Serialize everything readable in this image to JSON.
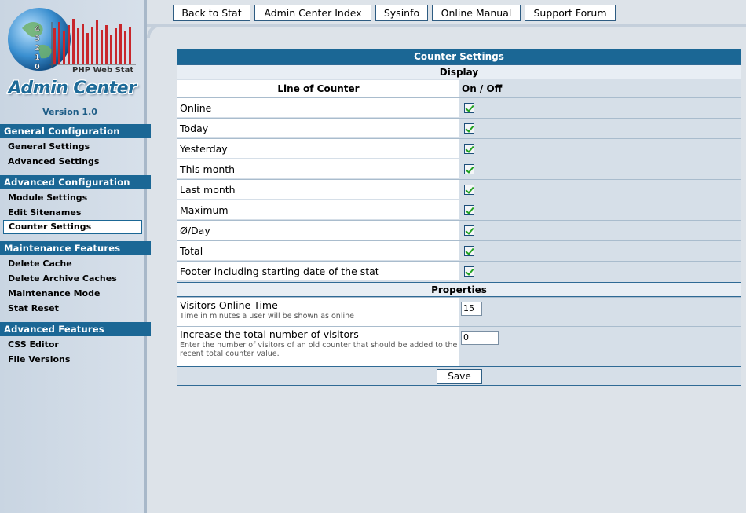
{
  "logo": {
    "brand_text": "PHP Web Stat",
    "title": "Admin Center",
    "version": "Version 1.0"
  },
  "sidebar": {
    "sections": [
      {
        "heading": "General Configuration",
        "items": [
          "General Settings",
          "Advanced Settings"
        ]
      },
      {
        "heading": "Advanced Configuration",
        "items": [
          "Module Settings",
          "Edit Sitenames",
          "Counter Settings"
        ]
      },
      {
        "heading": "Maintenance Features",
        "items": [
          "Delete Cache",
          "Delete Archive Caches",
          "Maintenance Mode",
          "Stat Reset"
        ]
      },
      {
        "heading": "Advanced Features",
        "items": [
          "CSS Editor",
          "File Versions"
        ]
      }
    ],
    "active_item": "Counter Settings"
  },
  "topnav": [
    "Back to Stat",
    "Admin Center Index",
    "Sysinfo",
    "Online Manual",
    "Support Forum"
  ],
  "main": {
    "title": "Counter Settings",
    "display_heading": "Display",
    "col_line": "Line of Counter",
    "col_onoff": "On / Off",
    "rows": [
      {
        "label": "Online",
        "checked": true
      },
      {
        "label": "Today",
        "checked": true
      },
      {
        "label": "Yesterday",
        "checked": true
      },
      {
        "label": "This month",
        "checked": true
      },
      {
        "label": "Last month",
        "checked": true
      },
      {
        "label": "Maximum",
        "checked": true
      },
      {
        "label": "Ø/Day",
        "checked": true
      },
      {
        "label": "Total",
        "checked": true
      },
      {
        "label": "Footer including starting date of the stat",
        "checked": true
      }
    ],
    "properties_heading": "Properties",
    "properties": [
      {
        "title": "Visitors Online Time",
        "desc": "Time in minutes a user will be shown as online",
        "value": "15"
      },
      {
        "title": "Increase the total number of visitors",
        "desc": "Enter the number of visitors of an old counter that should be added to the recent total counter value.",
        "value": "0"
      }
    ],
    "save_label": "Save"
  },
  "colors": {
    "accent": "#1b6795",
    "background": "#dde3e9",
    "sidebar": "#d0dae5",
    "check": "#21a121"
  }
}
